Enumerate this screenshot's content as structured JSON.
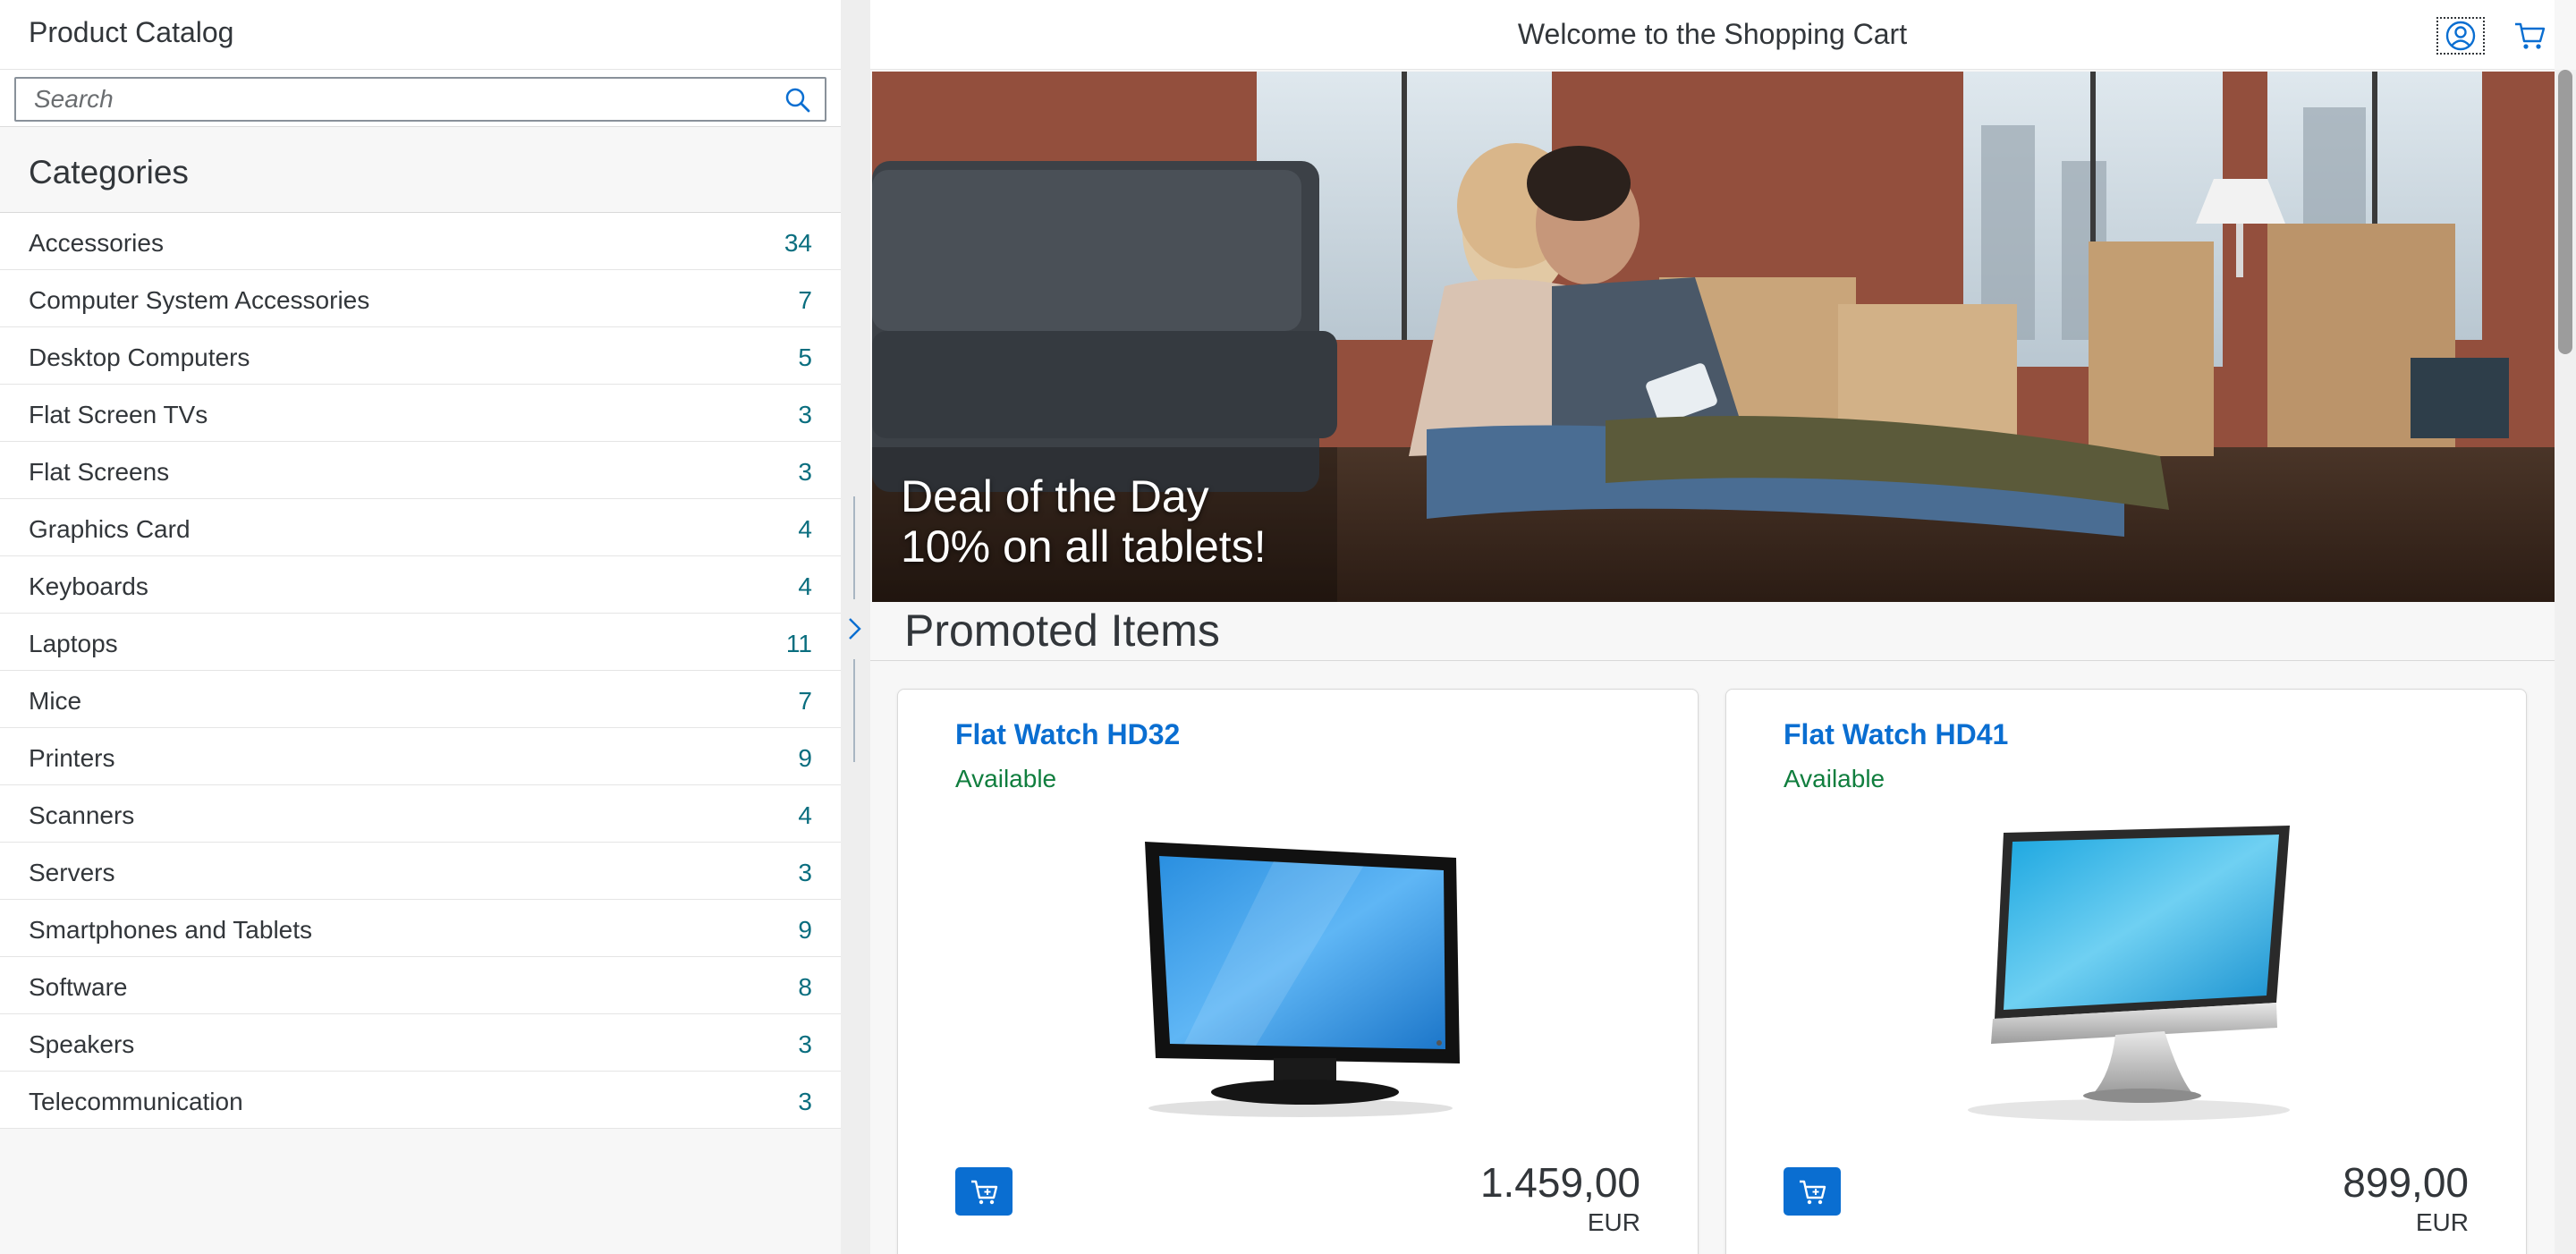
{
  "master": {
    "title": "Product Catalog",
    "search_placeholder": "Search",
    "categories_title": "Categories",
    "categories": [
      {
        "name": "Accessories",
        "count": "34"
      },
      {
        "name": "Computer System Accessories",
        "count": "7"
      },
      {
        "name": "Desktop Computers",
        "count": "5"
      },
      {
        "name": "Flat Screen TVs",
        "count": "3"
      },
      {
        "name": "Flat Screens",
        "count": "3"
      },
      {
        "name": "Graphics Card",
        "count": "4"
      },
      {
        "name": "Keyboards",
        "count": "4"
      },
      {
        "name": "Laptops",
        "count": "11"
      },
      {
        "name": "Mice",
        "count": "7"
      },
      {
        "name": "Printers",
        "count": "9"
      },
      {
        "name": "Scanners",
        "count": "4"
      },
      {
        "name": "Servers",
        "count": "3"
      },
      {
        "name": "Smartphones and Tablets",
        "count": "9"
      },
      {
        "name": "Software",
        "count": "8"
      },
      {
        "name": "Speakers",
        "count": "3"
      },
      {
        "name": "Telecommunication",
        "count": "3"
      }
    ]
  },
  "detail": {
    "title": "Welcome to the Shopping Cart",
    "hero": {
      "line1": "Deal of the Day",
      "line2": "10% on all tablets!"
    },
    "promoted_title": "Promoted Items",
    "products": [
      {
        "name": "Flat Watch HD32",
        "status": "Available",
        "price": "1.459,00",
        "currency": "EUR"
      },
      {
        "name": "Flat Watch HD41",
        "status": "Available",
        "price": "899,00",
        "currency": "EUR"
      }
    ]
  },
  "icons": {
    "search": "search-icon",
    "avatar": "user-avatar-icon",
    "cart": "cart-icon",
    "add_to_cart": "add-to-cart-icon",
    "splitter": "chevron-right-icon"
  },
  "colors": {
    "accent": "#0a6ed1",
    "count": "#0a6e7f",
    "status_available": "#107e3e"
  }
}
